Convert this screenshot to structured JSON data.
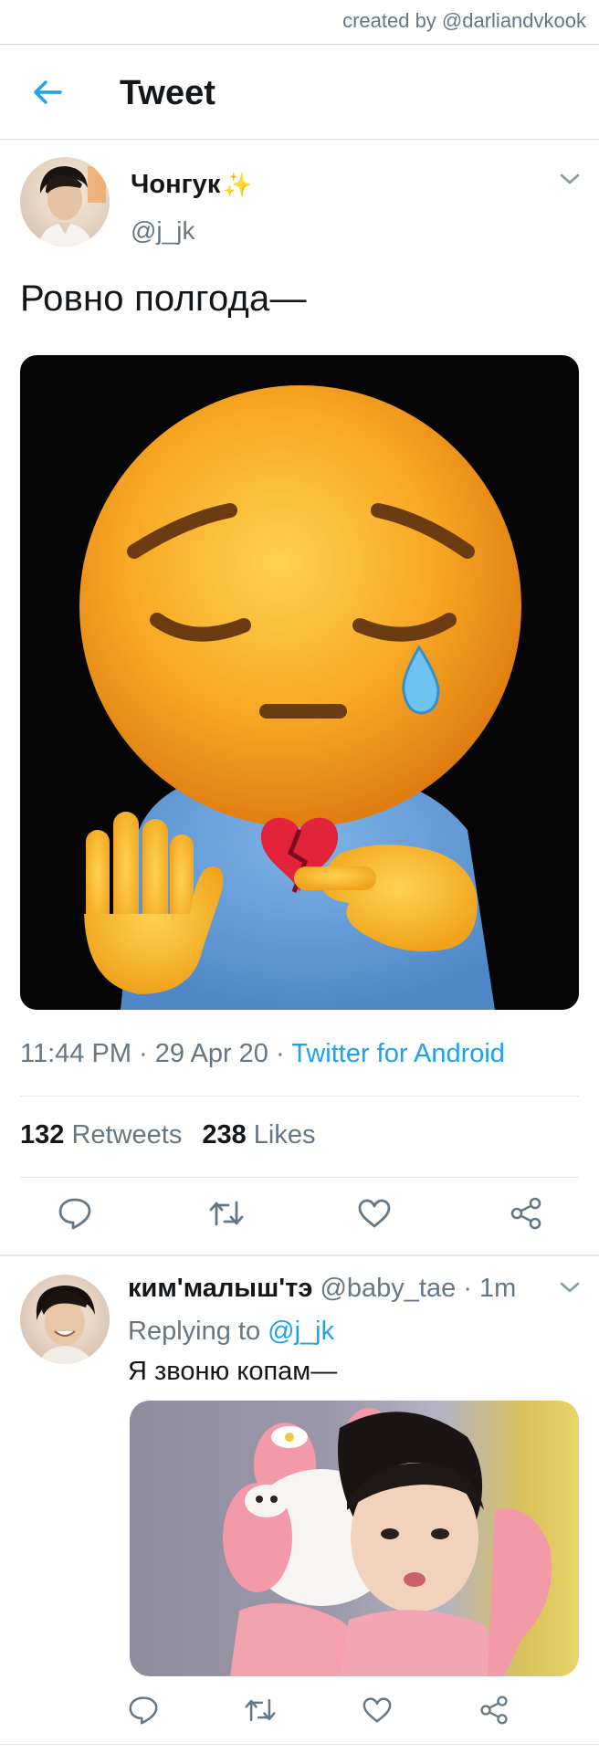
{
  "credit": "created by @darliandvkook",
  "header": {
    "title": "Tweet"
  },
  "tweet": {
    "author_name": "Чонгук",
    "author_emoji": "✨",
    "author_handle": "@j_jk",
    "text": "Ровно полгода—",
    "time": "11:44 PM",
    "date": "29 Apr 20",
    "separator": "·",
    "source": "Twitter for Android",
    "retweets_count": "132",
    "retweets_label": "Retweets",
    "likes_count": "238",
    "likes_label": "Likes"
  },
  "reply": {
    "author_name": "ким'малыш'тэ",
    "author_handle": "@baby_tae",
    "separator": "·",
    "time_ago": "1m",
    "replying_prefix": "Replying to",
    "replying_handle": "@j_jk",
    "text": "Я звоню копам—"
  },
  "colors": {
    "accent": "#1da1f2",
    "muted": "#657786",
    "text": "#14171a"
  },
  "icons": [
    "back-arrow-icon",
    "chevron-down-icon",
    "reply-icon",
    "retweet-icon",
    "like-icon",
    "share-icon"
  ]
}
